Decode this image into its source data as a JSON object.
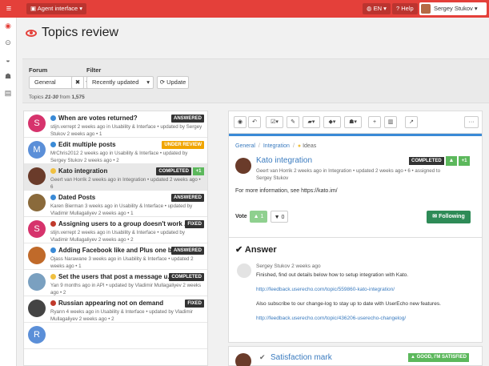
{
  "topbar": {
    "menu_icon": "menu-icon",
    "app_switch": "Agent interface ▾",
    "lang": "EN ▾",
    "help": "Help",
    "user": "Sergey Stukov ▾"
  },
  "sidebar": {
    "items": [
      {
        "icon": "eye-icon"
      },
      {
        "icon": "dashboard-icon"
      },
      {
        "icon": "chat-icon"
      },
      {
        "icon": "users-icon"
      },
      {
        "icon": "stats-icon"
      }
    ]
  },
  "page": {
    "title": "Topics review"
  },
  "filters": {
    "forum_label": "Forum",
    "forum_value": "General",
    "filter_label": "Filter",
    "filter_value": "Recently updated",
    "update_label": "Update",
    "range_text_prefix": "Topics ",
    "range_text": "21-30",
    "range_text_suffix": " from ",
    "total": "1,575"
  },
  "topics": [
    {
      "initial": "S",
      "avatar_color": "#d6336c",
      "title": "When are votes returned?",
      "dot": "#3a8ad6",
      "meta": "stijn.verrept 2 weeks ago in Usability & Interface • updated by Sergey Stukov 2 weeks ago • 1",
      "badge": "ANSWERED",
      "badge_class": "b-answered"
    },
    {
      "initial": "M",
      "avatar_color": "#5b8fd8",
      "title": "Edit multiple posts",
      "dot": "#3a8ad6",
      "meta": "MrChris2012 2 weeks ago in Usability & Interface • updated by Sergey Stukov 2 weeks ago • 2",
      "badge": "UNDER REVIEW",
      "badge_class": "b-review"
    },
    {
      "initial": "",
      "avatar_color": "#6a3b2a",
      "title": "Kato integration",
      "dot": "#f0c040",
      "meta": "Geert van Horrik 2 weeks ago in Integration • updated 2 weeks ago • 6",
      "badge": "COMPLETED",
      "badge_class": "b-completed",
      "plus": "+1"
    },
    {
      "initial": "",
      "avatar_color": "#8a6a3b",
      "title": "Dated Posts",
      "dot": "#3a8ad6",
      "meta": "Karen Bierman 3 weeks ago in Usability & Interface • updated by Vladimir Mullagaliyev 2 weeks ago • 1",
      "badge": "ANSWERED",
      "badge_class": "b-answered"
    },
    {
      "initial": "S",
      "avatar_color": "#d6336c",
      "title": "Assigning users to a group doesn't work ...",
      "dot": "#c0392b",
      "meta": "stijn.verrept 2 weeks ago in Usability & Interface • updated by Vladimir Mullagaliyev 2 weeks ago • 2",
      "badge": "FIXED",
      "badge_class": "b-fixed"
    },
    {
      "initial": "",
      "avatar_color": "#c06a2a",
      "title": "Adding Facebook like and Plus one b...",
      "dot": "#3a8ad6",
      "meta": "Ojass Narawane 3 weeks ago in Usability & Interface • updated 2 weeks ago • 1",
      "badge": "ANSWERED",
      "badge_class": "b-answered"
    },
    {
      "initial": "",
      "avatar_color": "#7aa0c0",
      "title": "Set the users that post a message u...",
      "dot": "#f0c040",
      "meta": "Yan 9 months ago in API • updated by Vladimir Mullagaliyev 2 weeks ago • 2",
      "badge": "COMPLETED",
      "badge_class": "b-completed"
    },
    {
      "initial": "",
      "avatar_color": "#444",
      "title": "Russian appearing not on demand",
      "dot": "#c0392b",
      "meta": "Ryann 4 weeks ago in Usability & Interface • updated by Vladimir Mullagaliyev 2 weeks ago • 2",
      "badge": "FIXED",
      "badge_class": "b-fixed"
    },
    {
      "initial": "R",
      "avatar_color": "#5b8fd8",
      "title": "",
      "dot": "",
      "meta": "",
      "badge": "",
      "badge_class": ""
    }
  ],
  "toolbar_icons": [
    "eye-icon",
    "reply-icon",
    "check-dropdown-icon",
    "edit-icon",
    "folder-dropdown-icon",
    "tag-dropdown-icon",
    "user-dropdown-icon",
    "plus-icon",
    "trash-icon",
    "external-icon",
    "more-icon"
  ],
  "detail": {
    "crumb1": "General",
    "crumb2": "Integration",
    "crumb3": "Ideas",
    "title": "Kato integration",
    "meta": "Geert van Horrik 2 weeks ago in Integration • updated 2 weeks ago • 6 • assigned to Sergey Stukov",
    "badge": "COMPLETED",
    "plus": "+1",
    "body": "For more information, see https://kato.im/",
    "vote_label": "Vote",
    "vote_up": "1",
    "vote_down": "0",
    "follow": "Following"
  },
  "answer": {
    "header": "Answer",
    "author_line": "Sergey Stukov 2 weeks ago",
    "line1": "Finished, find out details below how to setup integration with Kato.",
    "link1": "http://feedback.userecho.com/topic/559860-kato-integration/",
    "line2": "Also subscribe to our change-log to stay up to date with UserEcho new features.",
    "link2": "http://feedback.userecho.com/topic/436206-userecho-changelog/"
  },
  "satisfaction": {
    "title": "Satisfaction mark",
    "badge": "GOOD, I'M SATISFIED"
  }
}
